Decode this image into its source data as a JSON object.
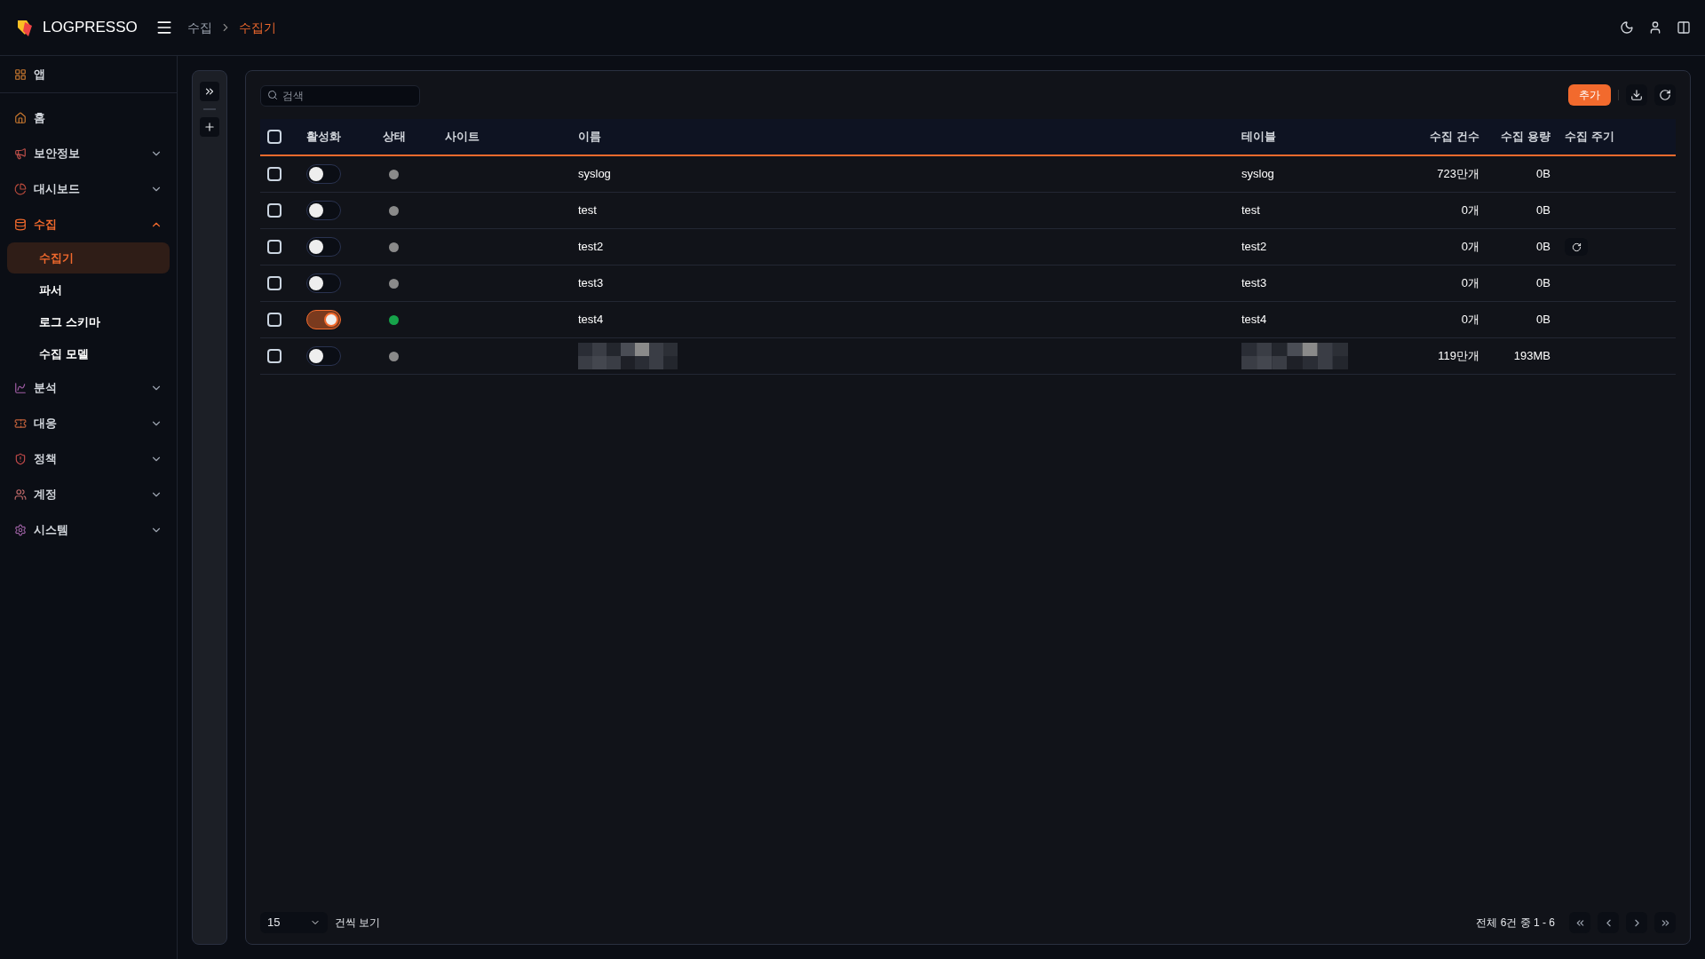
{
  "header": {
    "logo": "LOGPRESSO",
    "breadcrumb": [
      {
        "label": "수집",
        "selected": false
      },
      {
        "label": "수집기",
        "selected": true
      }
    ]
  },
  "sidebar": {
    "apps": "앱",
    "items": [
      {
        "label": "홈",
        "selected": false
      },
      {
        "label": "보안정보",
        "selected": false,
        "expanded": false
      },
      {
        "label": "대시보드",
        "selected": false,
        "expanded": false
      },
      {
        "label": "수집",
        "selected": true,
        "expanded": true,
        "children": [
          {
            "label": "수집기",
            "selected": true
          },
          {
            "label": "파서",
            "selected": false
          },
          {
            "label": "로그 스키마",
            "selected": false
          },
          {
            "label": "수집 모델",
            "selected": false
          }
        ]
      },
      {
        "label": "분석",
        "selected": false,
        "expanded": false
      },
      {
        "label": "대응",
        "selected": false,
        "expanded": false
      },
      {
        "label": "정책",
        "selected": false,
        "expanded": false
      },
      {
        "label": "계정",
        "selected": false,
        "expanded": false
      },
      {
        "label": "시스템",
        "selected": false,
        "expanded": false
      }
    ]
  },
  "toolbar": {
    "search": {
      "placeholder": "검색"
    },
    "add_button": "추가"
  },
  "table": {
    "header_checked": false,
    "columns": [
      "활성화",
      "상태",
      "사이트",
      "이름",
      "테이블",
      "수집 건수",
      "수집 용량",
      "수집 주기"
    ],
    "rows": [
      {
        "checked": false,
        "on": false,
        "color": "#8a8a8a",
        "name": "syslog",
        "table": "syslog",
        "count": "723만개",
        "size": "0B",
        "refresh": false,
        "redacted": false
      },
      {
        "checked": false,
        "on": false,
        "color": "#8a8a8a",
        "name": "test",
        "table": "test",
        "count": "0개",
        "size": "0B",
        "refresh": false,
        "redacted": false
      },
      {
        "checked": false,
        "on": false,
        "color": "#8a8a8a",
        "name": "test2",
        "table": "test2",
        "count": "0개",
        "size": "0B",
        "refresh": true,
        "redacted": false
      },
      {
        "checked": false,
        "on": false,
        "color": "#8a8a8a",
        "name": "test3",
        "table": "test3",
        "count": "0개",
        "size": "0B",
        "refresh": false,
        "redacted": false
      },
      {
        "checked": false,
        "on": true,
        "color": "#16a34a",
        "name": "test4",
        "table": "test4",
        "count": "0개",
        "size": "0B",
        "refresh": false,
        "redacted": false
      },
      {
        "checked": false,
        "on": false,
        "color": "#8a8a8a",
        "count": "119만개",
        "size": "193MB",
        "refresh": false,
        "redacted": true
      }
    ]
  },
  "footer": {
    "page_size": "15",
    "page_size_label": "건씩 보기",
    "summary": "전체 6건 중 1 - 6"
  }
}
